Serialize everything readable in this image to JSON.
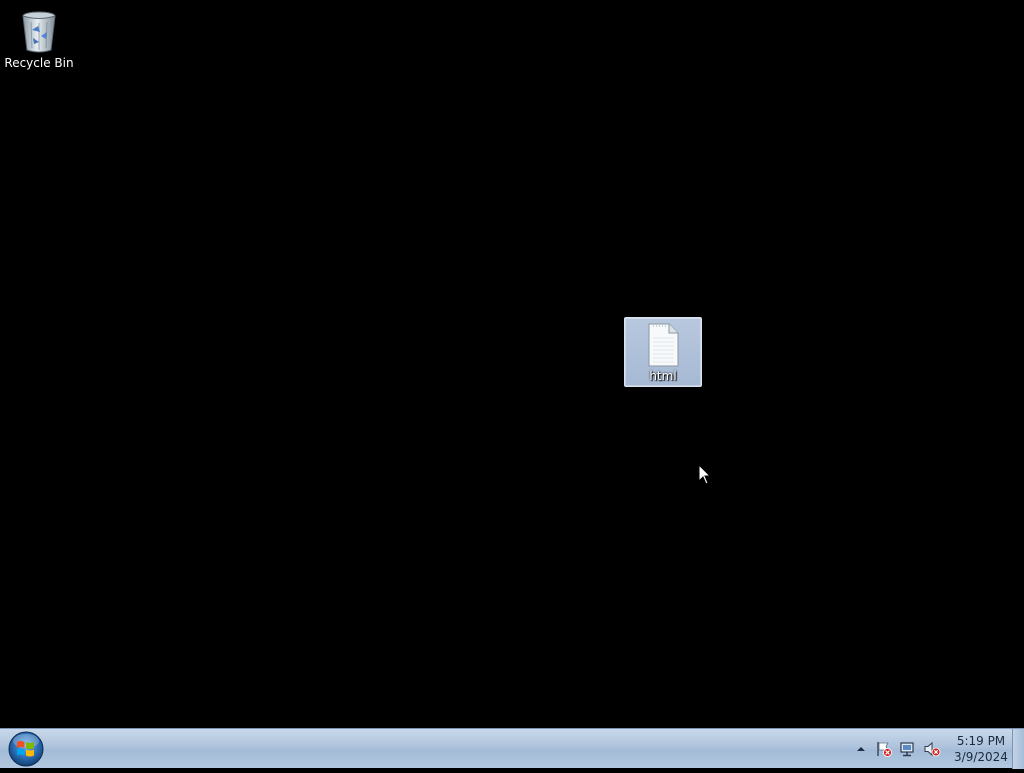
{
  "desktop": {
    "icons": [
      {
        "label": "Recycle Bin",
        "icon": "recycle-bin-icon",
        "selected": false
      },
      {
        "label": "html",
        "icon": "text-document-icon",
        "selected": true
      }
    ]
  },
  "taskbar": {
    "start_icon": "windows-logo-icon",
    "tray": {
      "icons": [
        "show-hidden-icons-chevron",
        "action-center-flag-icon",
        "network-icon",
        "volume-muted-icon"
      ],
      "clock": {
        "time": "5:19 PM",
        "date": "3/9/2024"
      }
    }
  },
  "colors": {
    "desktop_background": "#000000",
    "taskbar_light": "#c9d9eb",
    "taskbar_dark": "#a3bbd8",
    "selection_fill": "#b8c8de",
    "alert_red": "#d12020"
  }
}
